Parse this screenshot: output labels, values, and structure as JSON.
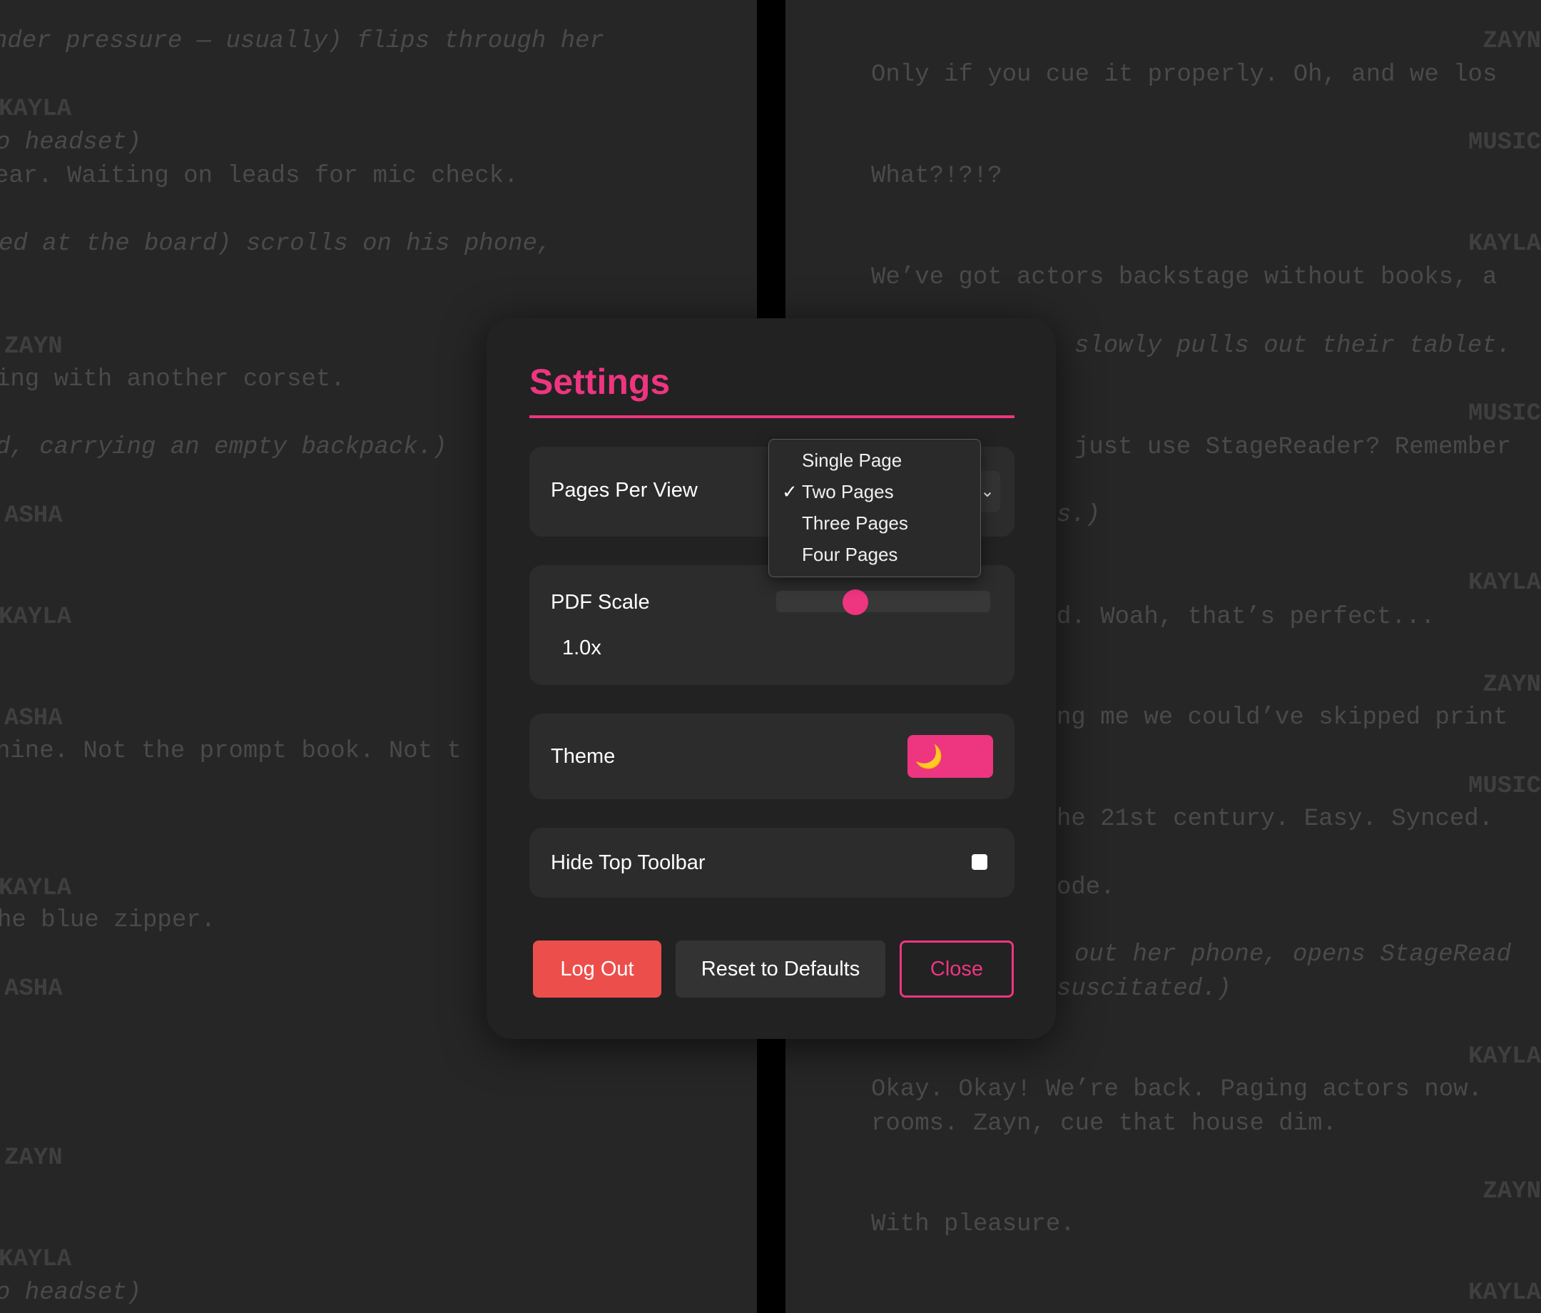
{
  "script_left": {
    "lines": [
      "nder pressure — usually) flips through her",
      "KAYLA",
      "o headset)",
      "ear. Waiting on leads for mic check.",
      "ed at the board) scrolls on his phone,",
      "ZAYN",
      "ing with another corset.",
      "d, carrying an empty backpack.)",
      "ASHA",
      "KAYLA",
      "ASHA",
      "hine. Not the prompt book. Not t",
      "KAYLA",
      "he blue zipper.",
      "ASHA",
      "ZAYN",
      "KAYLA",
      "o headset)"
    ]
  },
  "script_right": {
    "lines": [
      "ZAYN",
      "Only if you cue it properly. Oh, and we los",
      "MUSIC",
      "What?!?!?",
      "KAYLA",
      "We’ve got actors backstage without books, a",
      "slowly pulls out their tablet.",
      "MUSIC",
      "just use StageReader? Remember",
      "s.)",
      "KAYLA",
      "d. Woah, that’s perfect...",
      "ZAYN",
      "ng me we could’ve skipped print",
      "MUSIC",
      "he 21st century. Easy. Synced.",
      "ode.",
      "out her phone, opens StageRead",
      "suscitated.)",
      "KAYLA",
      "Okay. Okay! We’re back. Paging actors now.",
      "rooms. Zayn, cue that house dim.",
      "ZAYN",
      "With pleasure.",
      "KAYLA"
    ]
  },
  "settings": {
    "title": "Settings",
    "pages_per_view": {
      "label": "Pages Per View",
      "selected": "Two Pages",
      "options": [
        "Single Page",
        "Two Pages",
        "Three Pages",
        "Four Pages"
      ],
      "check_glyph": "✓"
    },
    "pdf_scale": {
      "label": "PDF Scale",
      "value_text": "1.0x",
      "slider_fraction": 0.37
    },
    "theme": {
      "label": "Theme",
      "icon": "moon-icon",
      "icon_glyph": "🌙"
    },
    "hide_toolbar": {
      "label": "Hide Top Toolbar",
      "checked": false
    },
    "buttons": {
      "logout": "Log Out",
      "reset": "Reset to Defaults",
      "close": "Close"
    }
  },
  "colors": {
    "accent": "#ee3580",
    "danger": "#ec4f4b",
    "page_bg": "#262626",
    "modal_bg": "#222222"
  }
}
